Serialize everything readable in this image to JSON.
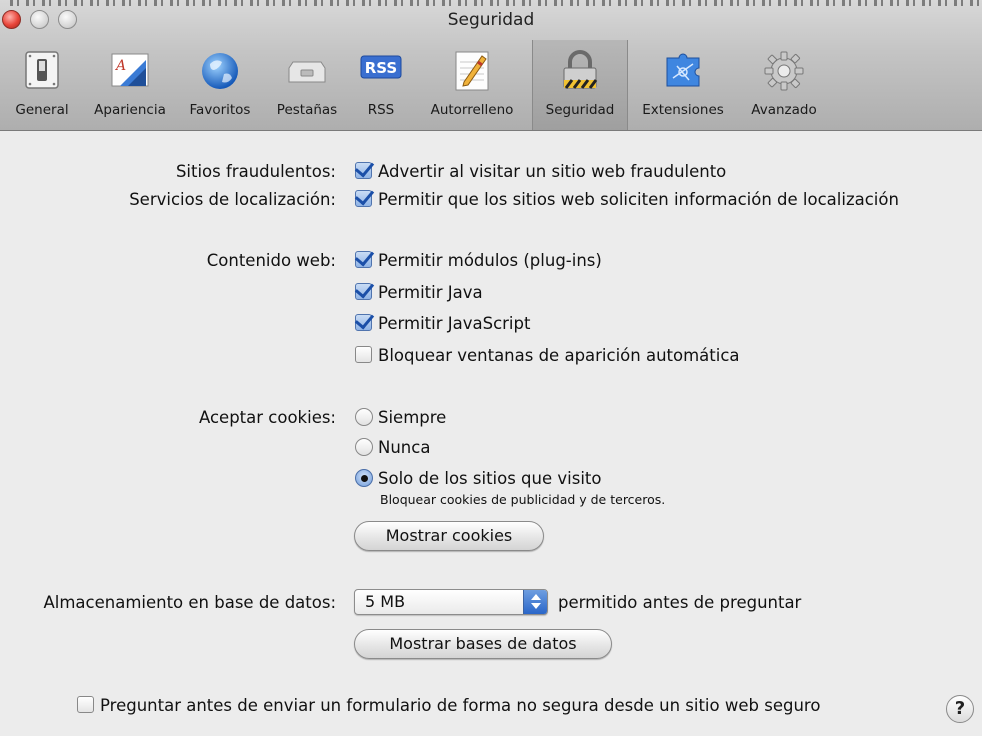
{
  "window": {
    "title": "Seguridad"
  },
  "toolbar": {
    "items": [
      {
        "label": "General",
        "icon": "switch-icon"
      },
      {
        "label": "Apariencia",
        "icon": "font-icon"
      },
      {
        "label": "Favoritos",
        "icon": "globe-icon"
      },
      {
        "label": "Pestañas",
        "icon": "tabs-icon"
      },
      {
        "label": "RSS",
        "icon": "rss-icon"
      },
      {
        "label": "Autorrelleno",
        "icon": "pencil-icon"
      },
      {
        "label": "Seguridad",
        "icon": "lock-icon",
        "selected": true
      },
      {
        "label": "Extensiones",
        "icon": "puzzle-icon"
      },
      {
        "label": "Avanzado",
        "icon": "gear-icon"
      }
    ]
  },
  "fraud": {
    "label": "Sitios fraudulentos:",
    "option": "Advertir al visitar un sitio web fraudulento",
    "checked": true
  },
  "location": {
    "label": "Servicios de localización:",
    "option": "Permitir que los sitios web soliciten información de localización",
    "checked": true
  },
  "web_content": {
    "label": "Contenido web:",
    "options": [
      {
        "text": "Permitir módulos (plug-ins)",
        "checked": true
      },
      {
        "text": "Permitir Java",
        "checked": true
      },
      {
        "text": "Permitir JavaScript",
        "checked": true
      },
      {
        "text": "Bloquear ventanas de aparición automática",
        "checked": false
      }
    ]
  },
  "cookies": {
    "label": "Aceptar cookies:",
    "options": [
      {
        "text": "Siempre",
        "selected": false
      },
      {
        "text": "Nunca",
        "selected": false
      },
      {
        "text": "Solo de los sitios que visito",
        "selected": true
      }
    ],
    "note": "Bloquear cookies de publicidad y de terceros.",
    "show_button": "Mostrar cookies"
  },
  "database": {
    "label": "Almacenamiento en base de datos:",
    "value": "5 MB",
    "suffix": "permitido antes de preguntar",
    "show_button": "Mostrar bases de datos"
  },
  "insecure_form": {
    "text": "Preguntar antes de enviar un formulario de forma no segura desde un sitio web seguro",
    "checked": false
  },
  "help": {
    "glyph": "?"
  },
  "colors": {
    "accent": "#2a66c9",
    "check": "#1b4fa8"
  }
}
